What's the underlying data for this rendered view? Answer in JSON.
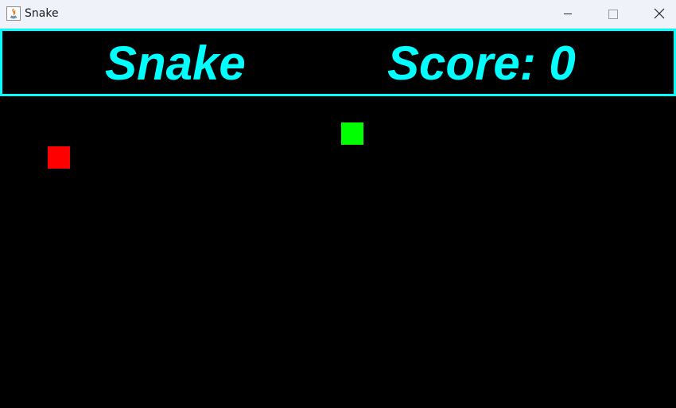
{
  "window": {
    "title": "Snake",
    "controls": {
      "minimize_icon": "minimize-icon",
      "maximize_icon": "maximize-icon",
      "close_icon": "close-icon"
    }
  },
  "header": {
    "game_title": "Snake",
    "score_label": "Score: ",
    "score_value": "0"
  },
  "board": {
    "food": {
      "color": "#ff0000"
    },
    "snake": {
      "color": "#00ff00",
      "length": 1
    }
  },
  "colors": {
    "accent": "#00ffff",
    "background": "#000000"
  }
}
